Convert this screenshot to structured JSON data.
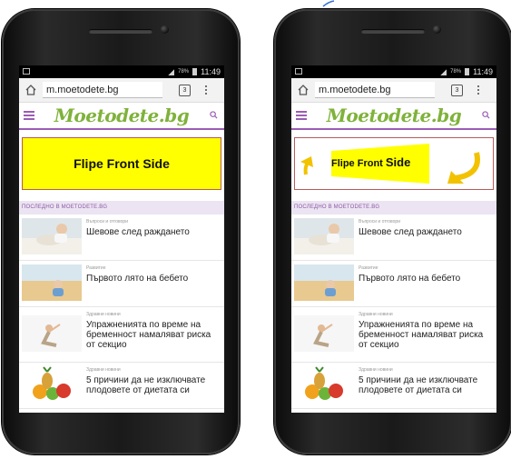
{
  "phones": [
    {
      "status_time": "11:49",
      "status_batt": "78%",
      "url": "m.moetodete.bg",
      "logo": "Moetodete.bg",
      "banner_text": "Flipe Front Side",
      "latest_label": "ПОСЛЕДНО В MOETODETE.BG",
      "articles": [
        {
          "category": "Въпроси и отговори",
          "title": "Шевове след раждането"
        },
        {
          "category": "Развитие",
          "title": "Първото лято на бебето"
        },
        {
          "category": "Здравни новини",
          "title": "Упражненията по време на бременност намаляват риска от секцио"
        },
        {
          "category": "Здравни новини",
          "title": "5 причини да не изключвате плодовете от диетата си"
        }
      ]
    },
    {
      "status_time": "11:49",
      "status_batt": "78%",
      "url": "m.moetodete.bg",
      "logo": "Moetodete.bg",
      "banner_text_a": "Flipe Front",
      "banner_text_b": "Side",
      "latest_label": "ПОСЛЕДНО В MOETODETE.BG",
      "articles": [
        {
          "category": "Въпроси и отговори",
          "title": "Шевове след раждането"
        },
        {
          "category": "Развитие",
          "title": "Първото лято на бебето"
        },
        {
          "category": "Здравни новини",
          "title": "Упражненията по време на бременност намаляват риска от секцио"
        },
        {
          "category": "Здравни новини",
          "title": "5 причини да не изключвате плодовете от диетата си"
        }
      ]
    }
  ],
  "colors": {
    "accent": "#9b5cb4",
    "logo": "#7fb23a",
    "banner_yellow": "#ffff00",
    "arrow": "#f2c200"
  }
}
